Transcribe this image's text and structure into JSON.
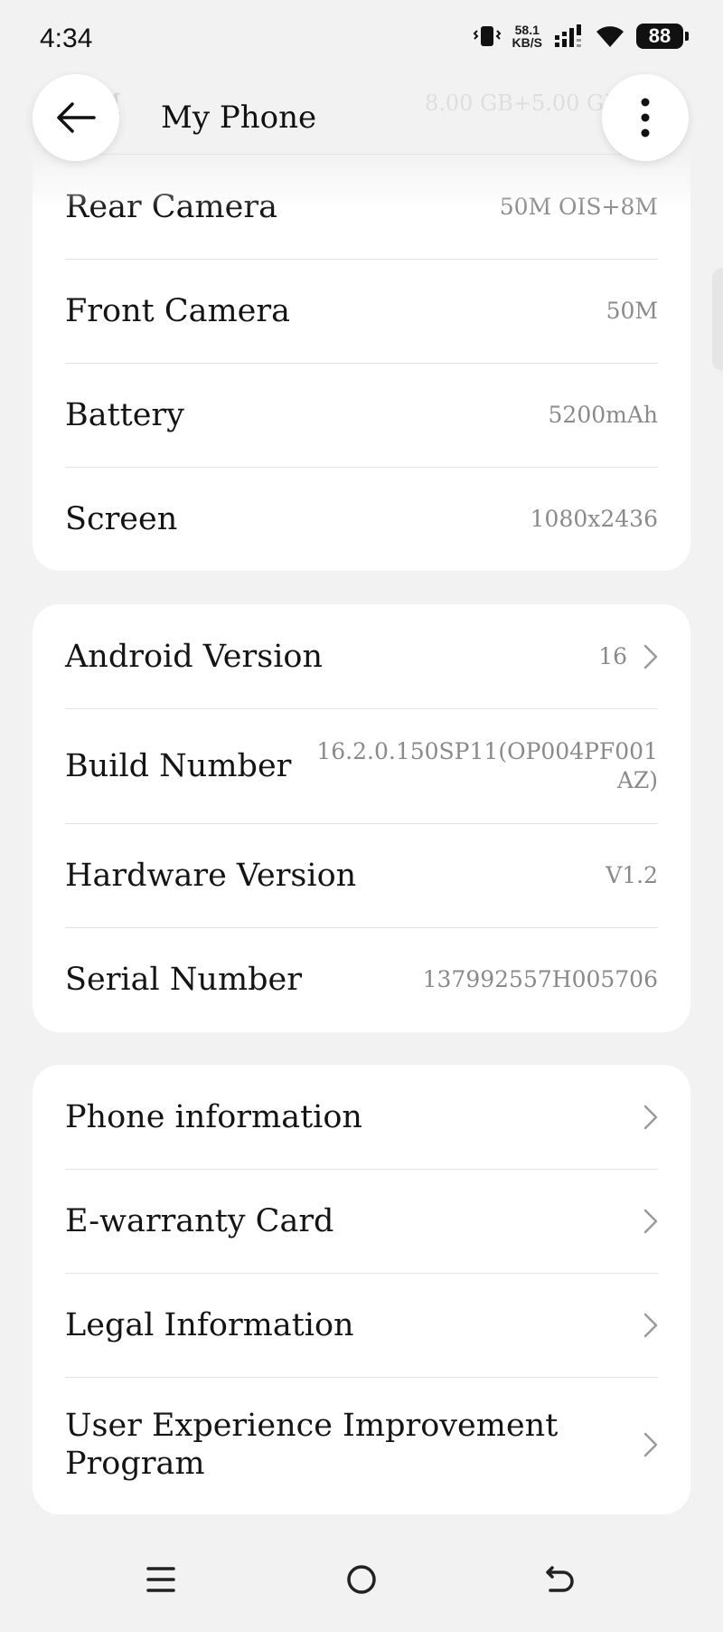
{
  "status_bar": {
    "time": "4:34",
    "net_speed_value": "58.1",
    "net_speed_unit": "KB/S",
    "battery_level": "88"
  },
  "header": {
    "title": "My Phone",
    "ghost_left": "M",
    "ghost_right": "8.00 GB+5.00 GB"
  },
  "specs": [
    {
      "label": "Rear Camera",
      "value": "50M OIS+8M"
    },
    {
      "label": "Front Camera",
      "value": "50M"
    },
    {
      "label": "Battery",
      "value": "5200mAh"
    },
    {
      "label": "Screen",
      "value": "1080x2436"
    }
  ],
  "software": {
    "android_label": "Android Version",
    "android_value": "16",
    "build_label": "Build Number",
    "build_value": "16.2.0.150SP11(OP004PF001AZ)",
    "hardware_label": "Hardware Version",
    "hardware_value": "V1.2",
    "serial_label": "Serial Number",
    "serial_value": "137992557H005706"
  },
  "links": [
    {
      "label": "Phone information"
    },
    {
      "label": "E-warranty Card"
    },
    {
      "label": "Legal Information"
    },
    {
      "label": "User Experience Improvement Program"
    }
  ],
  "icons": {
    "back": "arrow-left-icon",
    "more": "more-vertical-icon",
    "chevron": "chevron-right-icon",
    "nav_menu": "menu-icon",
    "nav_home": "home-circle-icon",
    "nav_back": "back-curve-icon"
  },
  "colors": {
    "background": "#f2f2f2",
    "card": "#ffffff",
    "primary_text": "#141414",
    "secondary_text": "#8a8a8a"
  }
}
